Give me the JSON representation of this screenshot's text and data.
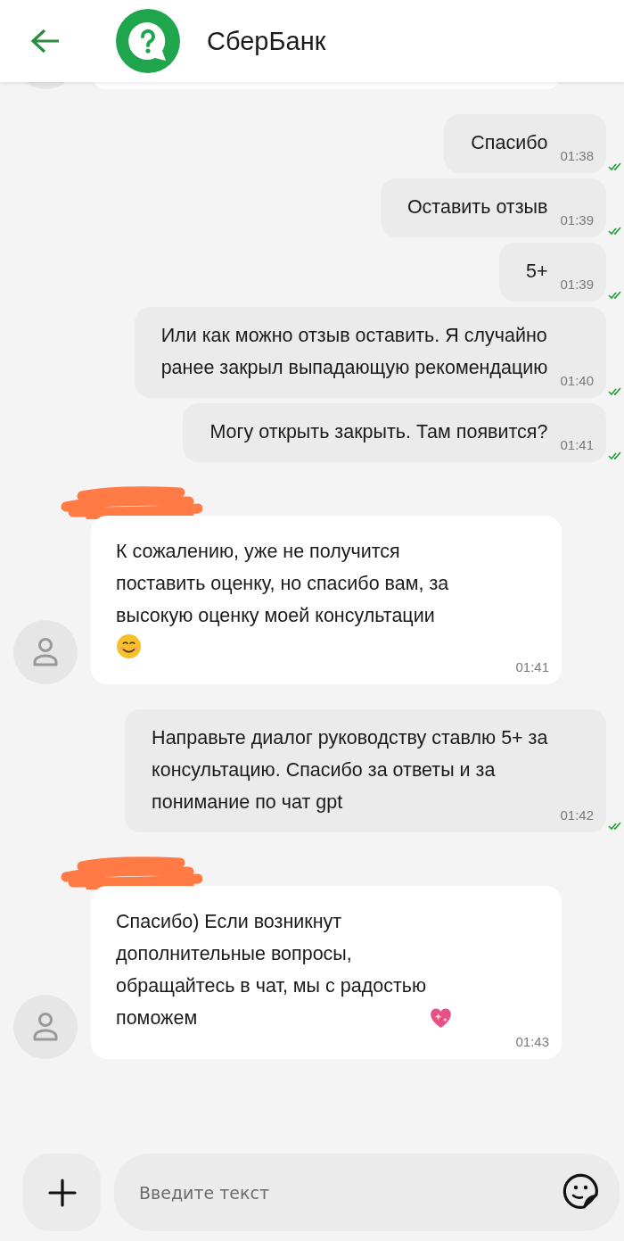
{
  "header": {
    "title": "СберБанк"
  },
  "messages": [
    {
      "kind": "cut_off"
    },
    {
      "kind": "outgoing",
      "text": "Спасибо",
      "time": "01:38",
      "read": true
    },
    {
      "kind": "outgoing",
      "text": "Оставить отзыв",
      "time": "01:39",
      "read": true
    },
    {
      "kind": "outgoing",
      "text": "5+",
      "time": "01:39",
      "read": true
    },
    {
      "kind": "outgoing",
      "text": "Или как можно отзыв оставить. Я случайно\nранее закрыл выпадающую рекомендацию",
      "time": "01:40",
      "read": true
    },
    {
      "kind": "outgoing",
      "text": "Могу открыть закрыть. Там появится?",
      "time": "01:41",
      "read": true
    },
    {
      "kind": "incoming",
      "redacted": true,
      "text": "К сожалению, уже не получится\nпоставить оценку, но спасибо вам, за\nвысокую оценку моей консультации",
      "emoji_line": {
        "kind": "smile"
      },
      "time": "01:41"
    },
    {
      "kind": "outgoing",
      "text": "Направьте диалог руководству ставлю 5+ за\nконсультацию. Спасибо за ответы и за\nпонимание по чат gpt",
      "time": "01:42",
      "read": true
    },
    {
      "kind": "incoming",
      "redacted": true,
      "text": "Спасибо) Если возникнут\nдополнительные вопросы,\nобращайтесь в чат, мы с радостью\nпоможем",
      "inline_emoji": {
        "kind": "sparkling_heart"
      },
      "time": "01:43"
    }
  ],
  "composer": {
    "placeholder": "Введите текст"
  }
}
